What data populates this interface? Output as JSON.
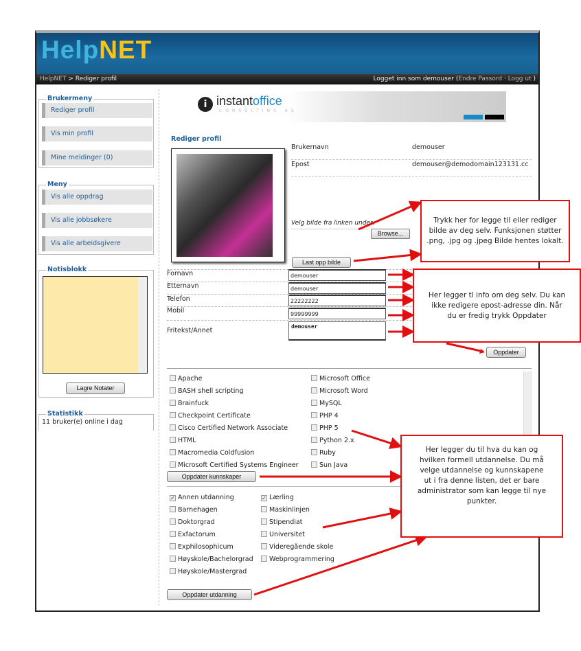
{
  "header": {
    "logo_part1": "Help",
    "logo_part2": "NET"
  },
  "breadcrumb": {
    "root": "HelpNET",
    "separator": ">",
    "current": "Rediger profil"
  },
  "login": {
    "prefix": "Logget inn som demouser",
    "open": "(",
    "change_password": "Endre Passord",
    "dot": "·",
    "logout": "Logg ut",
    "close": ")"
  },
  "sidebar": {
    "user_menu": {
      "title": "Brukermeny",
      "items": [
        {
          "label": "Rediger profil"
        },
        {
          "label": "Vis min profil"
        },
        {
          "label": "Mine meldinger (0)"
        }
      ]
    },
    "menu": {
      "title": "Meny",
      "items": [
        {
          "label": "Vis alle oppdrag"
        },
        {
          "label": "Vis alle jobbsøkere"
        },
        {
          "label": "Vis alle arbeidsgivere"
        }
      ]
    },
    "notepad": {
      "title": "Notisblokk",
      "value": "",
      "save_label": "Lagre Notater"
    },
    "stats": {
      "title": "Statistikk",
      "text": "11 bruker(e) online i dag"
    }
  },
  "banner": {
    "brand": "instant",
    "brand2": "office",
    "sub": "CONSULTING AS"
  },
  "profile": {
    "title": "Rediger profil",
    "username_label": "Brukernavn",
    "username": "demouser",
    "email_label": "Epost",
    "email": "demouser@demodomain123131.cc",
    "choose_image": "Velg bilde fra linken under:",
    "browse_label": "Browse...",
    "upload_label": "Last opp bilde",
    "fields": [
      {
        "label": "Fornavn",
        "value": "demouser"
      },
      {
        "label": "Etternavn",
        "value": "demouser"
      },
      {
        "label": "Telefon",
        "value": "22222222"
      },
      {
        "label": "Mobil",
        "value": "99999999"
      }
    ],
    "freetext_label": "Fritekst/Annet",
    "freetext": "demouser",
    "update_label": "Oppdater"
  },
  "skills": {
    "col1": [
      {
        "label": "Apache",
        "checked": false
      },
      {
        "label": "BASH shell scripting",
        "checked": false
      },
      {
        "label": "Brainfuck",
        "checked": false
      },
      {
        "label": "Checkpoint Certificate",
        "checked": false
      },
      {
        "label": "Cisco Certified Network Associate",
        "checked": false
      },
      {
        "label": "HTML",
        "checked": false
      },
      {
        "label": "Macromedia Coldfusion",
        "checked": false
      },
      {
        "label": "Microsoft Certified Systems Engineer",
        "checked": false
      }
    ],
    "col2": [
      {
        "label": "Microsoft Office",
        "checked": false
      },
      {
        "label": "Microsoft Word",
        "checked": false
      },
      {
        "label": "MySQL",
        "checked": false
      },
      {
        "label": "PHP 4",
        "checked": false
      },
      {
        "label": "PHP 5",
        "checked": false
      },
      {
        "label": "Python 2.x",
        "checked": false
      },
      {
        "label": "Ruby",
        "checked": false
      },
      {
        "label": "Sun Java",
        "checked": false
      }
    ],
    "update_label": "Oppdater kunnskaper"
  },
  "education": {
    "col1": [
      {
        "label": "Annen utdanning",
        "checked": true
      },
      {
        "label": "Barnehagen",
        "checked": false
      },
      {
        "label": "Doktorgrad",
        "checked": false
      },
      {
        "label": "Exfactorum",
        "checked": false
      },
      {
        "label": "Exphilosophicum",
        "checked": false
      },
      {
        "label": "Høyskole/Bachelorgrad",
        "checked": false
      },
      {
        "label": "Høyskole/Mastergrad",
        "checked": false
      }
    ],
    "col2": [
      {
        "label": "Lærling",
        "checked": true
      },
      {
        "label": "Maskinlinjen",
        "checked": false
      },
      {
        "label": "Stipendiat",
        "checked": false
      },
      {
        "label": "Universitet",
        "checked": false
      },
      {
        "label": "Videregående skole",
        "checked": false
      },
      {
        "label": "Webprogrammering",
        "checked": false
      }
    ],
    "update_label": "Oppdater utdanning"
  },
  "annotations": [
    "Trykk her for legge til eller rediger bilde av deg selv. Funksjonen støtter .png, .jpg og .jpeg Bilde hentes lokalt.",
    "Her legger tl info om deg selv. Du kan ikke redigere epost-adresse din. Når du er fredig trykk Oppdater",
    "Her legger du til hva du kan og hvilken formell utdannelse. Du må velge utdannelse og kunnskapene ut i fra denne listen, det er bare administrator som kan legge til nye punkter."
  ],
  "colors": {
    "accent": "#1f5e9c",
    "header": "#1b6aa0",
    "logo_yellow": "#f7c21a",
    "annotation": "#e01010",
    "notepad": "#fde9a9"
  }
}
